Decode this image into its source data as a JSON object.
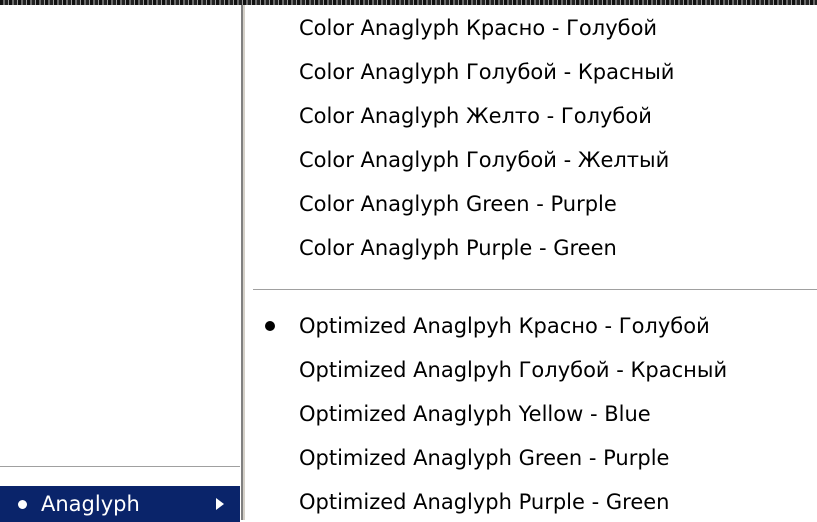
{
  "left_menu": {
    "selected_item": {
      "label": "Anaglyph",
      "icon": "submenu-arrow-icon"
    }
  },
  "submenu": {
    "color_items": [
      {
        "label": "Color Anaglyph Красно - Голубой"
      },
      {
        "label": "Color Anaglyph Голубой - Красный"
      },
      {
        "label": "Color Anaglyph Желто - Голубой"
      },
      {
        "label": "Color Anaglyph Голубой - Желтый"
      },
      {
        "label": "Color Anaglyph Green - Purple"
      },
      {
        "label": "Color Anaglyph Purple - Green"
      }
    ],
    "optimized_items": [
      {
        "label": "Optimized Anaglpyh Красно - Голубой",
        "checked": true
      },
      {
        "label": "Optimized Anaglpyh Голубой - Красный",
        "checked": false
      },
      {
        "label": "Optimized Anaglyph Yellow - Blue",
        "checked": false
      },
      {
        "label": "Optimized Anaglyph Green - Purple",
        "checked": false
      },
      {
        "label": "Optimized Anaglyph Purple - Green",
        "checked": false
      }
    ]
  },
  "colors": {
    "highlight": "#0a246a",
    "menu_bg": "#ffffff",
    "text": "#000000"
  }
}
